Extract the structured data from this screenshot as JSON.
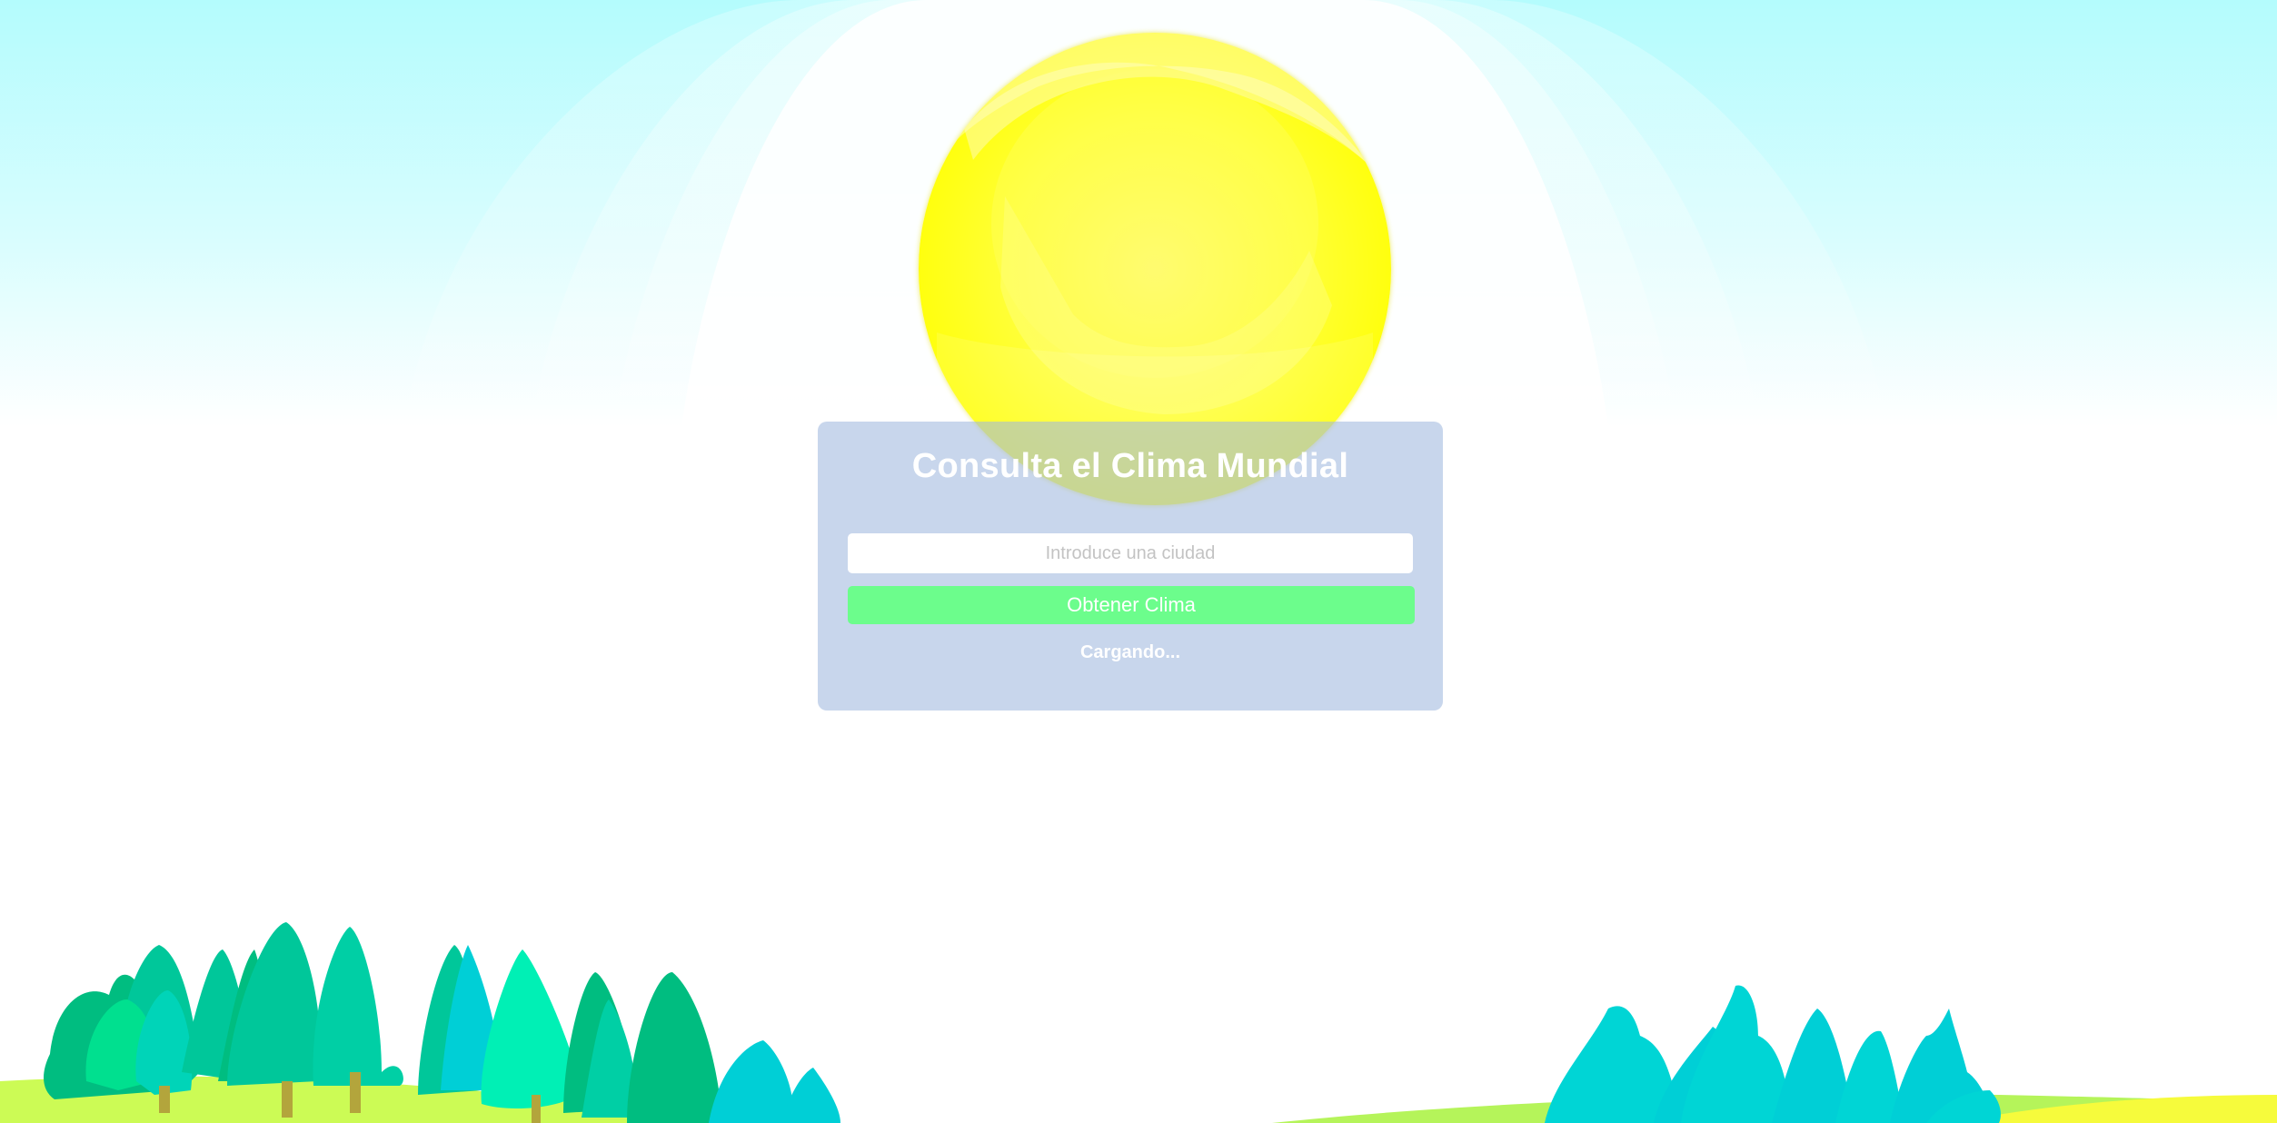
{
  "app": {
    "title": "Consulta el Clima Mundial"
  },
  "search": {
    "placeholder": "Introduce una ciudad",
    "value": ""
  },
  "actions": {
    "submit_label": "Obtener Clima"
  },
  "status": {
    "text": "Cargando..."
  },
  "scene": {
    "sky_color": "#b4fcfd",
    "sun_color": "#ffff00",
    "button_color": "#6cfd8c",
    "panel_color": "#a0b8de",
    "tree_colors": [
      "#00c79a",
      "#00e3b8",
      "#00cfd6",
      "#00bd80"
    ],
    "grass_color": "#ccfb55"
  }
}
